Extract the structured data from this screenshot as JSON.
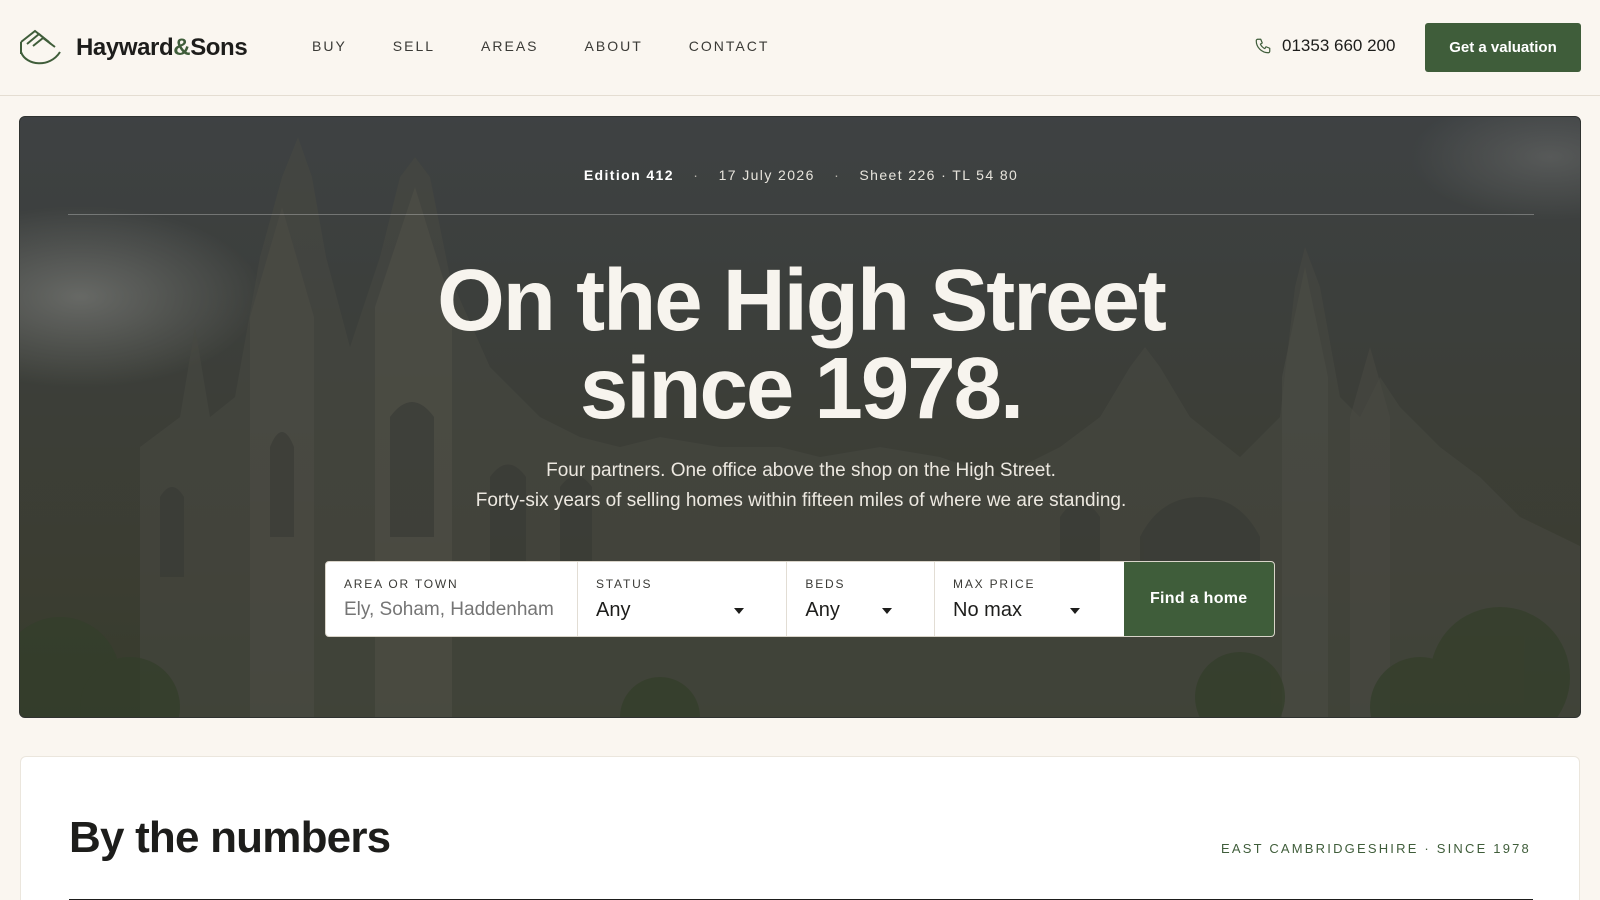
{
  "brand": {
    "name_part1": "Hayward",
    "amp": "&",
    "name_part2": "Sons"
  },
  "nav": [
    {
      "label": "BUY"
    },
    {
      "label": "SELL"
    },
    {
      "label": "AREAS"
    },
    {
      "label": "ABOUT"
    },
    {
      "label": "CONTACT"
    }
  ],
  "header": {
    "phone": "01353 660 200",
    "cta_label": "Get a valuation"
  },
  "hero": {
    "edition": "Edition 412",
    "date": "17 July 2026",
    "sheet": "Sheet 226 · TL 54 80",
    "dot": "·",
    "headline_line1": "On the High Street",
    "headline_line2": "since 1978.",
    "sub_line1": "Four partners. One office above the shop on the High Street.",
    "sub_line2": "Forty-six years of selling homes within fifteen miles of where we are standing."
  },
  "search": {
    "area_label": "AREA OR TOWN",
    "area_placeholder": "Ely, Soham, Haddenham",
    "status_label": "STATUS",
    "status_value": "Any",
    "beds_label": "BEDS",
    "beds_value": "Any",
    "price_label": "MAX PRICE",
    "price_value": "No max",
    "submit_label": "Find a home"
  },
  "numbers": {
    "title": "By the numbers",
    "tag": "EAST CAMBRIDGESHIRE · SINCE 1978"
  },
  "colors": {
    "accent": "#3f5d3a",
    "background": "#faf6f0"
  }
}
